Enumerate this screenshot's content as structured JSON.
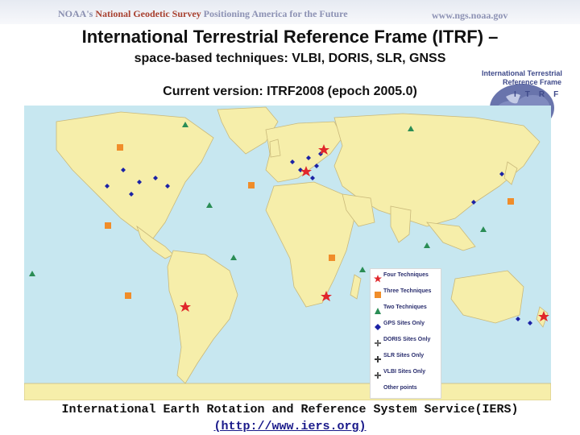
{
  "header": {
    "org": "NOAA's",
    "agency": "National Geodetic Survey",
    "tagline": "Positioning America for the Future",
    "url": "www.ngs.noaa.gov"
  },
  "slide": {
    "title": "International Terrestrial Reference Frame (ITRF) –",
    "subtitle": "space-based techniques: VLBI, DORIS, SLR, GNSS",
    "current_version": "Current version: ITRF2008 (epoch 2005.0)"
  },
  "logo": {
    "line1": "International Terrestrial",
    "line2": "Reference Frame",
    "letters": "ITRF",
    "icon": "globe-icon"
  },
  "map": {
    "ocean_color": "#c7e7f0",
    "land_color": "#f6eeaa",
    "border_color": "#c9b97a"
  },
  "legend": {
    "items": [
      {
        "label": "Four Techniques",
        "symbol": "star",
        "color": "#e0262b"
      },
      {
        "label": "Three Techniques",
        "symbol": "square",
        "color": "#f08d2a"
      },
      {
        "label": "Two Techniques",
        "symbol": "triangle",
        "color": "#2a8d55"
      },
      {
        "label": "GPS Sites Only",
        "symbol": "diamond",
        "color": "#1b22a5"
      },
      {
        "label": "DORIS Sites Only",
        "symbol": "plus",
        "color": "#666666"
      },
      {
        "label": "SLR Sites Only",
        "symbol": "plus",
        "color": "#3a3a3a"
      },
      {
        "label": "VLBI Sites Only",
        "symbol": "plus",
        "color": "#555555"
      },
      {
        "label": "Other points",
        "symbol": "none",
        "color": "#333333"
      }
    ]
  },
  "footer": {
    "text": "International Earth Rotation and Reference System Service(IERS)",
    "link": "(http://www.iers.org)"
  }
}
